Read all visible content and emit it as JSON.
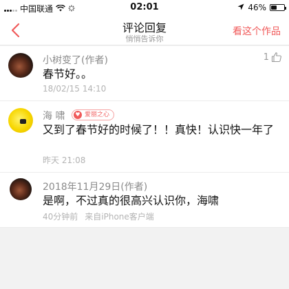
{
  "status_bar": {
    "carrier": "中国联通",
    "time": "02:01",
    "battery": "46%",
    "battery_level": 0.46,
    "icons": [
      "signal-icon",
      "wifi-icon",
      "loading-icon",
      "location-icon",
      "battery-icon"
    ]
  },
  "nav": {
    "title": "评论回复",
    "subtitle": "悄悄告诉你",
    "action": "看这个作品",
    "accent": "#f05a5a",
    "back_icon": "chevron-left-icon"
  },
  "comments": [
    {
      "author": "小树变了(作者)",
      "text": "春节好。。",
      "meta": "18/02/15 14:10",
      "likes": "1"
    },
    {
      "author": "海 啸",
      "badge": "爱丽之心",
      "text": "又到了春节好的时候了！！真快！认识快一年了",
      "meta": "昨天 21:08"
    },
    {
      "author": "2018年11月29日(作者)",
      "text": "是啊，不过真的很高兴认识你，海啸",
      "meta": "40分钟前",
      "source": "来自iPhone客户端"
    }
  ]
}
